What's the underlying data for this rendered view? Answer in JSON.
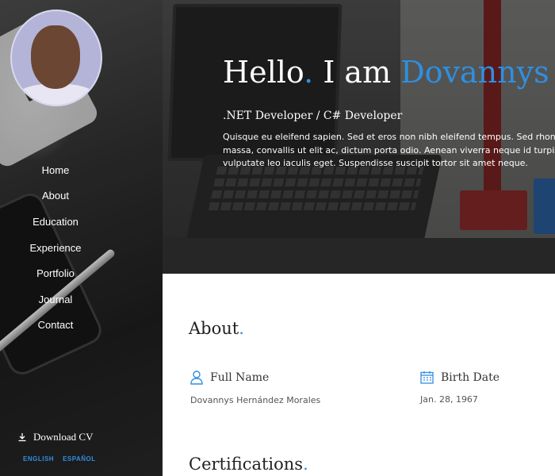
{
  "profile": {
    "avatar_alt": "Profile photo"
  },
  "nav": {
    "items": [
      {
        "label": "Home"
      },
      {
        "label": "About"
      },
      {
        "label": "Education"
      },
      {
        "label": "Experience"
      },
      {
        "label": "Portfolio"
      },
      {
        "label": "Journal"
      },
      {
        "label": "Contact"
      }
    ]
  },
  "sidebar": {
    "download_label": "Download CV",
    "download_icon": "download-icon",
    "languages": [
      "ENGLISH",
      "ESPAÑOL"
    ]
  },
  "hero": {
    "greeting": "Hello",
    "dot": ".",
    "i_am": " I am ",
    "name": "Dovannys",
    "subtitle": ".NET Developer / C# Developer",
    "description": "Quisque eu eleifend sapien. Sed et eros non nibh eleifend tempus. Sed rhoncus massa, convallis ut elit ac, dictum porta odio. Aenean viverra neque id turpis ma vulputate leo iaculis eget. Suspendisse suscipit tortor sit amet neque."
  },
  "about": {
    "title": "About",
    "dot": ".",
    "full_name_label": "Full Name",
    "full_name_value": "Dovannys Hernández Morales",
    "full_name_icon": "user-icon",
    "birth_date_label": "Birth Date",
    "birth_date_value": "Jan. 28, 1967",
    "birth_date_icon": "calendar-icon"
  },
  "certifications": {
    "title": "Certifications",
    "dot": "."
  },
  "colors": {
    "accent": "#2f8fe0",
    "sidebar_bg": "#2f2f2f",
    "text_dark": "#222222"
  }
}
